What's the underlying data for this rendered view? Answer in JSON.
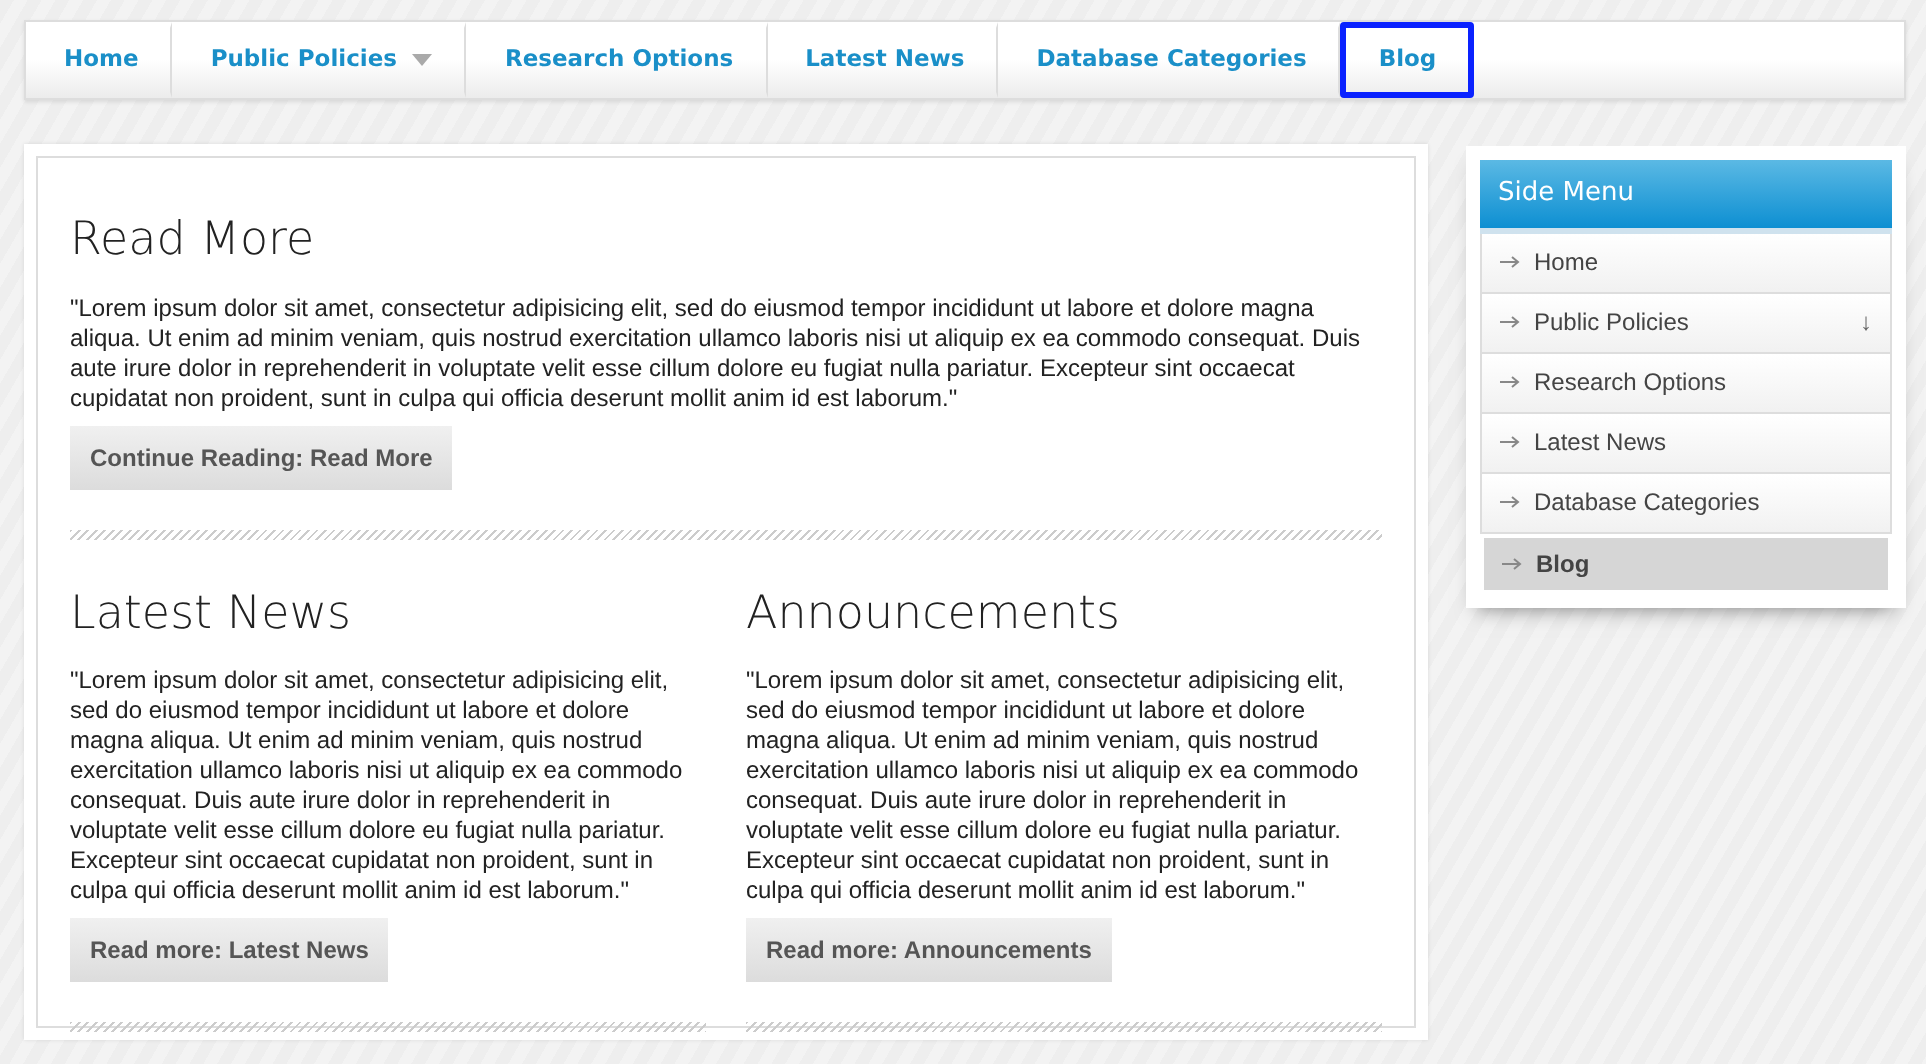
{
  "nav": [
    {
      "label": "Home",
      "selected": false,
      "dropdown": false
    },
    {
      "label": "Public Policies",
      "selected": false,
      "dropdown": true
    },
    {
      "label": "Research Options",
      "selected": false,
      "dropdown": false
    },
    {
      "label": "Latest News",
      "selected": false,
      "dropdown": false
    },
    {
      "label": "Database Categories",
      "selected": false,
      "dropdown": false
    },
    {
      "label": "Blog",
      "selected": true,
      "dropdown": false
    }
  ],
  "main": {
    "title": "Read More",
    "text": "\"Lorem ipsum dolor sit amet, consectetur adipisicing elit, sed do eiusmod tempor incididunt ut labore et dolore magna aliqua. Ut enim ad minim veniam, quis nostrud exercitation ullamco laboris nisi ut aliquip ex ea commodo consequat. Duis aute irure dolor in reprehenderit in voluptate velit esse cillum dolore eu fugiat nulla pariatur. Excepteur sint occaecat cupidatat non proident, sunt in culpa qui officia deserunt mollit anim id est laborum.\"",
    "button": "Continue Reading: Read More"
  },
  "columns": [
    {
      "title": "Latest News",
      "text": "\"Lorem ipsum dolor sit amet, consectetur adipisicing elit, sed do eiusmod tempor incididunt ut labore et dolore magna aliqua. Ut enim ad minim veniam, quis nostrud exercitation ullamco laboris nisi ut aliquip ex ea commodo consequat. Duis aute irure dolor in reprehenderit in voluptate velit esse cillum dolore eu fugiat nulla pariatur. Excepteur sint occaecat cupidatat non proident, sunt in culpa qui officia deserunt mollit anim id est laborum.\"",
      "button": "Read more: Latest News"
    },
    {
      "title": "Announcements",
      "text": "\"Lorem ipsum dolor sit amet, consectetur adipisicing elit, sed do eiusmod tempor incididunt ut labore et dolore magna aliqua. Ut enim ad minim veniam, quis nostrud exercitation ullamco laboris nisi ut aliquip ex ea commodo consequat. Duis aute irure dolor in reprehenderit in voluptate velit esse cillum dolore eu fugiat nulla pariatur. Excepteur sint occaecat cupidatat non proident, sunt in culpa qui officia deserunt mollit anim id est laborum.\"",
      "button": "Read more: Announcements"
    }
  ],
  "side_menu": {
    "title": "Side Menu",
    "items": [
      {
        "label": "Home",
        "selected": false
      },
      {
        "label": "Public Policies",
        "selected": false,
        "submenu_mark": "↓"
      },
      {
        "label": "Research Options",
        "selected": false
      },
      {
        "label": "Latest News",
        "selected": false
      },
      {
        "label": "Database Categories",
        "selected": false
      },
      {
        "label": "Blog",
        "selected": true
      }
    ]
  }
}
